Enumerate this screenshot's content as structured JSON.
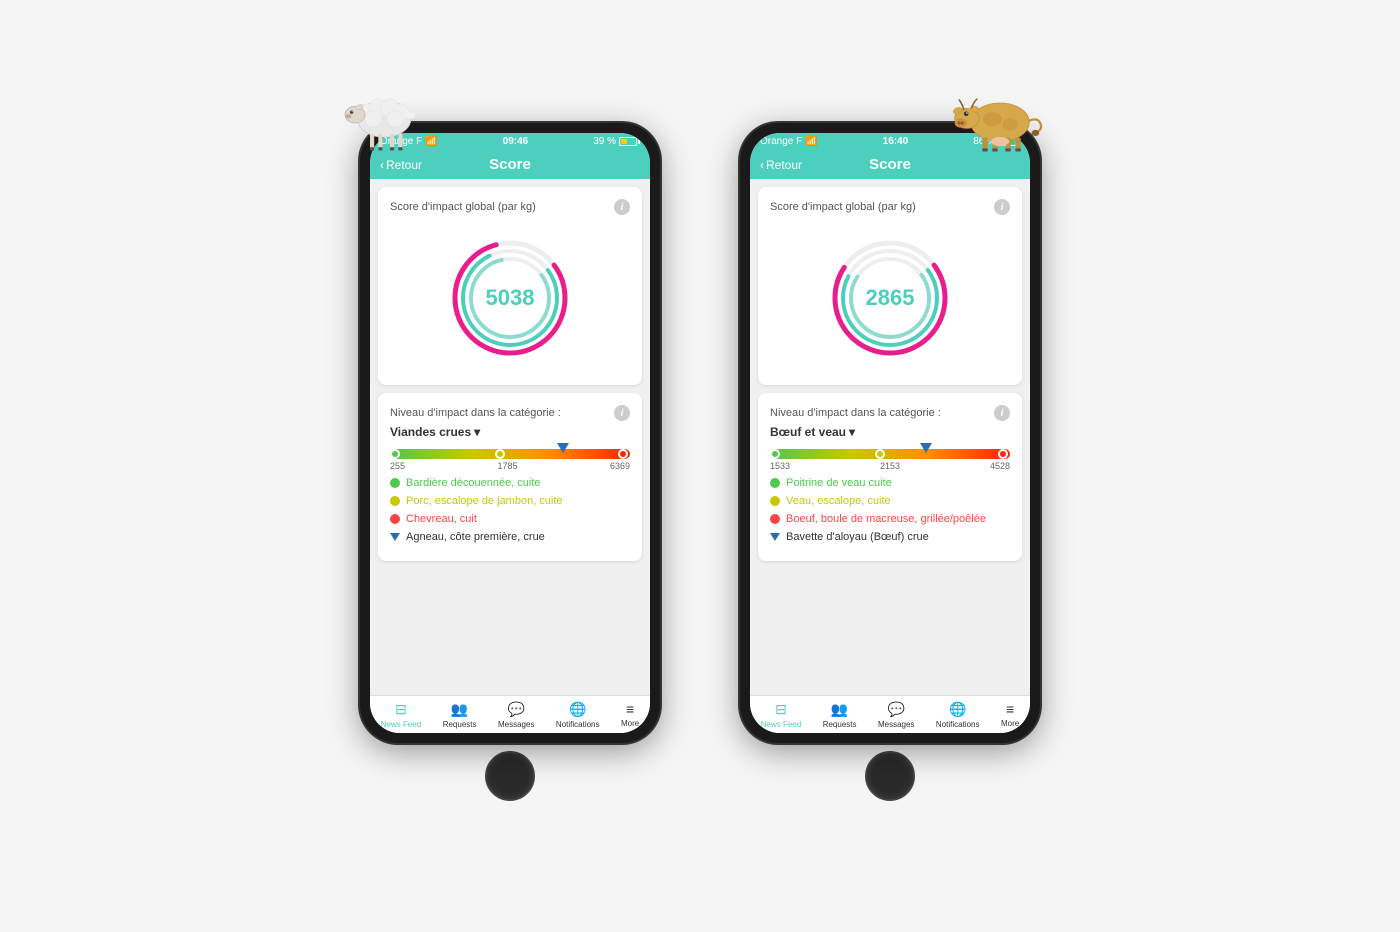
{
  "phone1": {
    "status": {
      "carrier": "Orange F",
      "wifi": "📶",
      "time": "09:46",
      "battery_pct": "39 %"
    },
    "nav": {
      "back": "Retour",
      "title": "Score"
    },
    "score_card": {
      "title": "Score d'impact global (par kg)",
      "value": "5038"
    },
    "impact": {
      "label": "Niveau d'impact dans la catégorie :",
      "category": "Viandes crues",
      "bar_min": "255",
      "bar_mid": "1785",
      "bar_max": "6369",
      "items": [
        {
          "color": "green",
          "text": "Bardière découennée, cuite"
        },
        {
          "color": "yellow",
          "text": "Porc, escalope de jambon, cuite"
        },
        {
          "color": "red",
          "text": "Chevreau, cuit"
        },
        {
          "color": "triangle",
          "text": "Agneau, côte première, crue"
        }
      ]
    },
    "tabs": [
      {
        "icon": "▬",
        "label": "News Feed",
        "active": true
      },
      {
        "icon": "👥",
        "label": "Requests",
        "active": false
      },
      {
        "icon": "💬",
        "label": "Messages",
        "active": false
      },
      {
        "icon": "🌐",
        "label": "Notifications",
        "active": false
      },
      {
        "icon": "≡",
        "label": "More",
        "active": false
      }
    ]
  },
  "phone2": {
    "status": {
      "carrier": "Orange F",
      "wifi": "📶",
      "time": "16:40",
      "battery_pct": "86 %"
    },
    "nav": {
      "back": "Retour",
      "title": "Score"
    },
    "score_card": {
      "title": "Score d'impact global (par kg)",
      "value": "2865"
    },
    "impact": {
      "label": "Niveau d'impact dans la catégorie :",
      "category": "Bœuf et veau",
      "bar_min": "1533",
      "bar_mid": "2153",
      "bar_max": "4528",
      "items": [
        {
          "color": "green",
          "text": "Poitrine de veau cuite"
        },
        {
          "color": "yellow",
          "text": "Veau, escalope, cuite"
        },
        {
          "color": "red",
          "text": "Boeuf, boule de macreuse, grillée/poêlée"
        },
        {
          "color": "triangle",
          "text": "Bavette d'aloyau (Bœuf) crue"
        }
      ]
    },
    "tabs": [
      {
        "icon": "▬",
        "label": "News Feed",
        "active": true
      },
      {
        "icon": "👥",
        "label": "Requests",
        "active": false
      },
      {
        "icon": "💬",
        "label": "Messages",
        "active": false
      },
      {
        "icon": "🌐",
        "label": "Notifications",
        "active": false
      },
      {
        "icon": "≡",
        "label": "More",
        "active": false
      }
    ]
  }
}
